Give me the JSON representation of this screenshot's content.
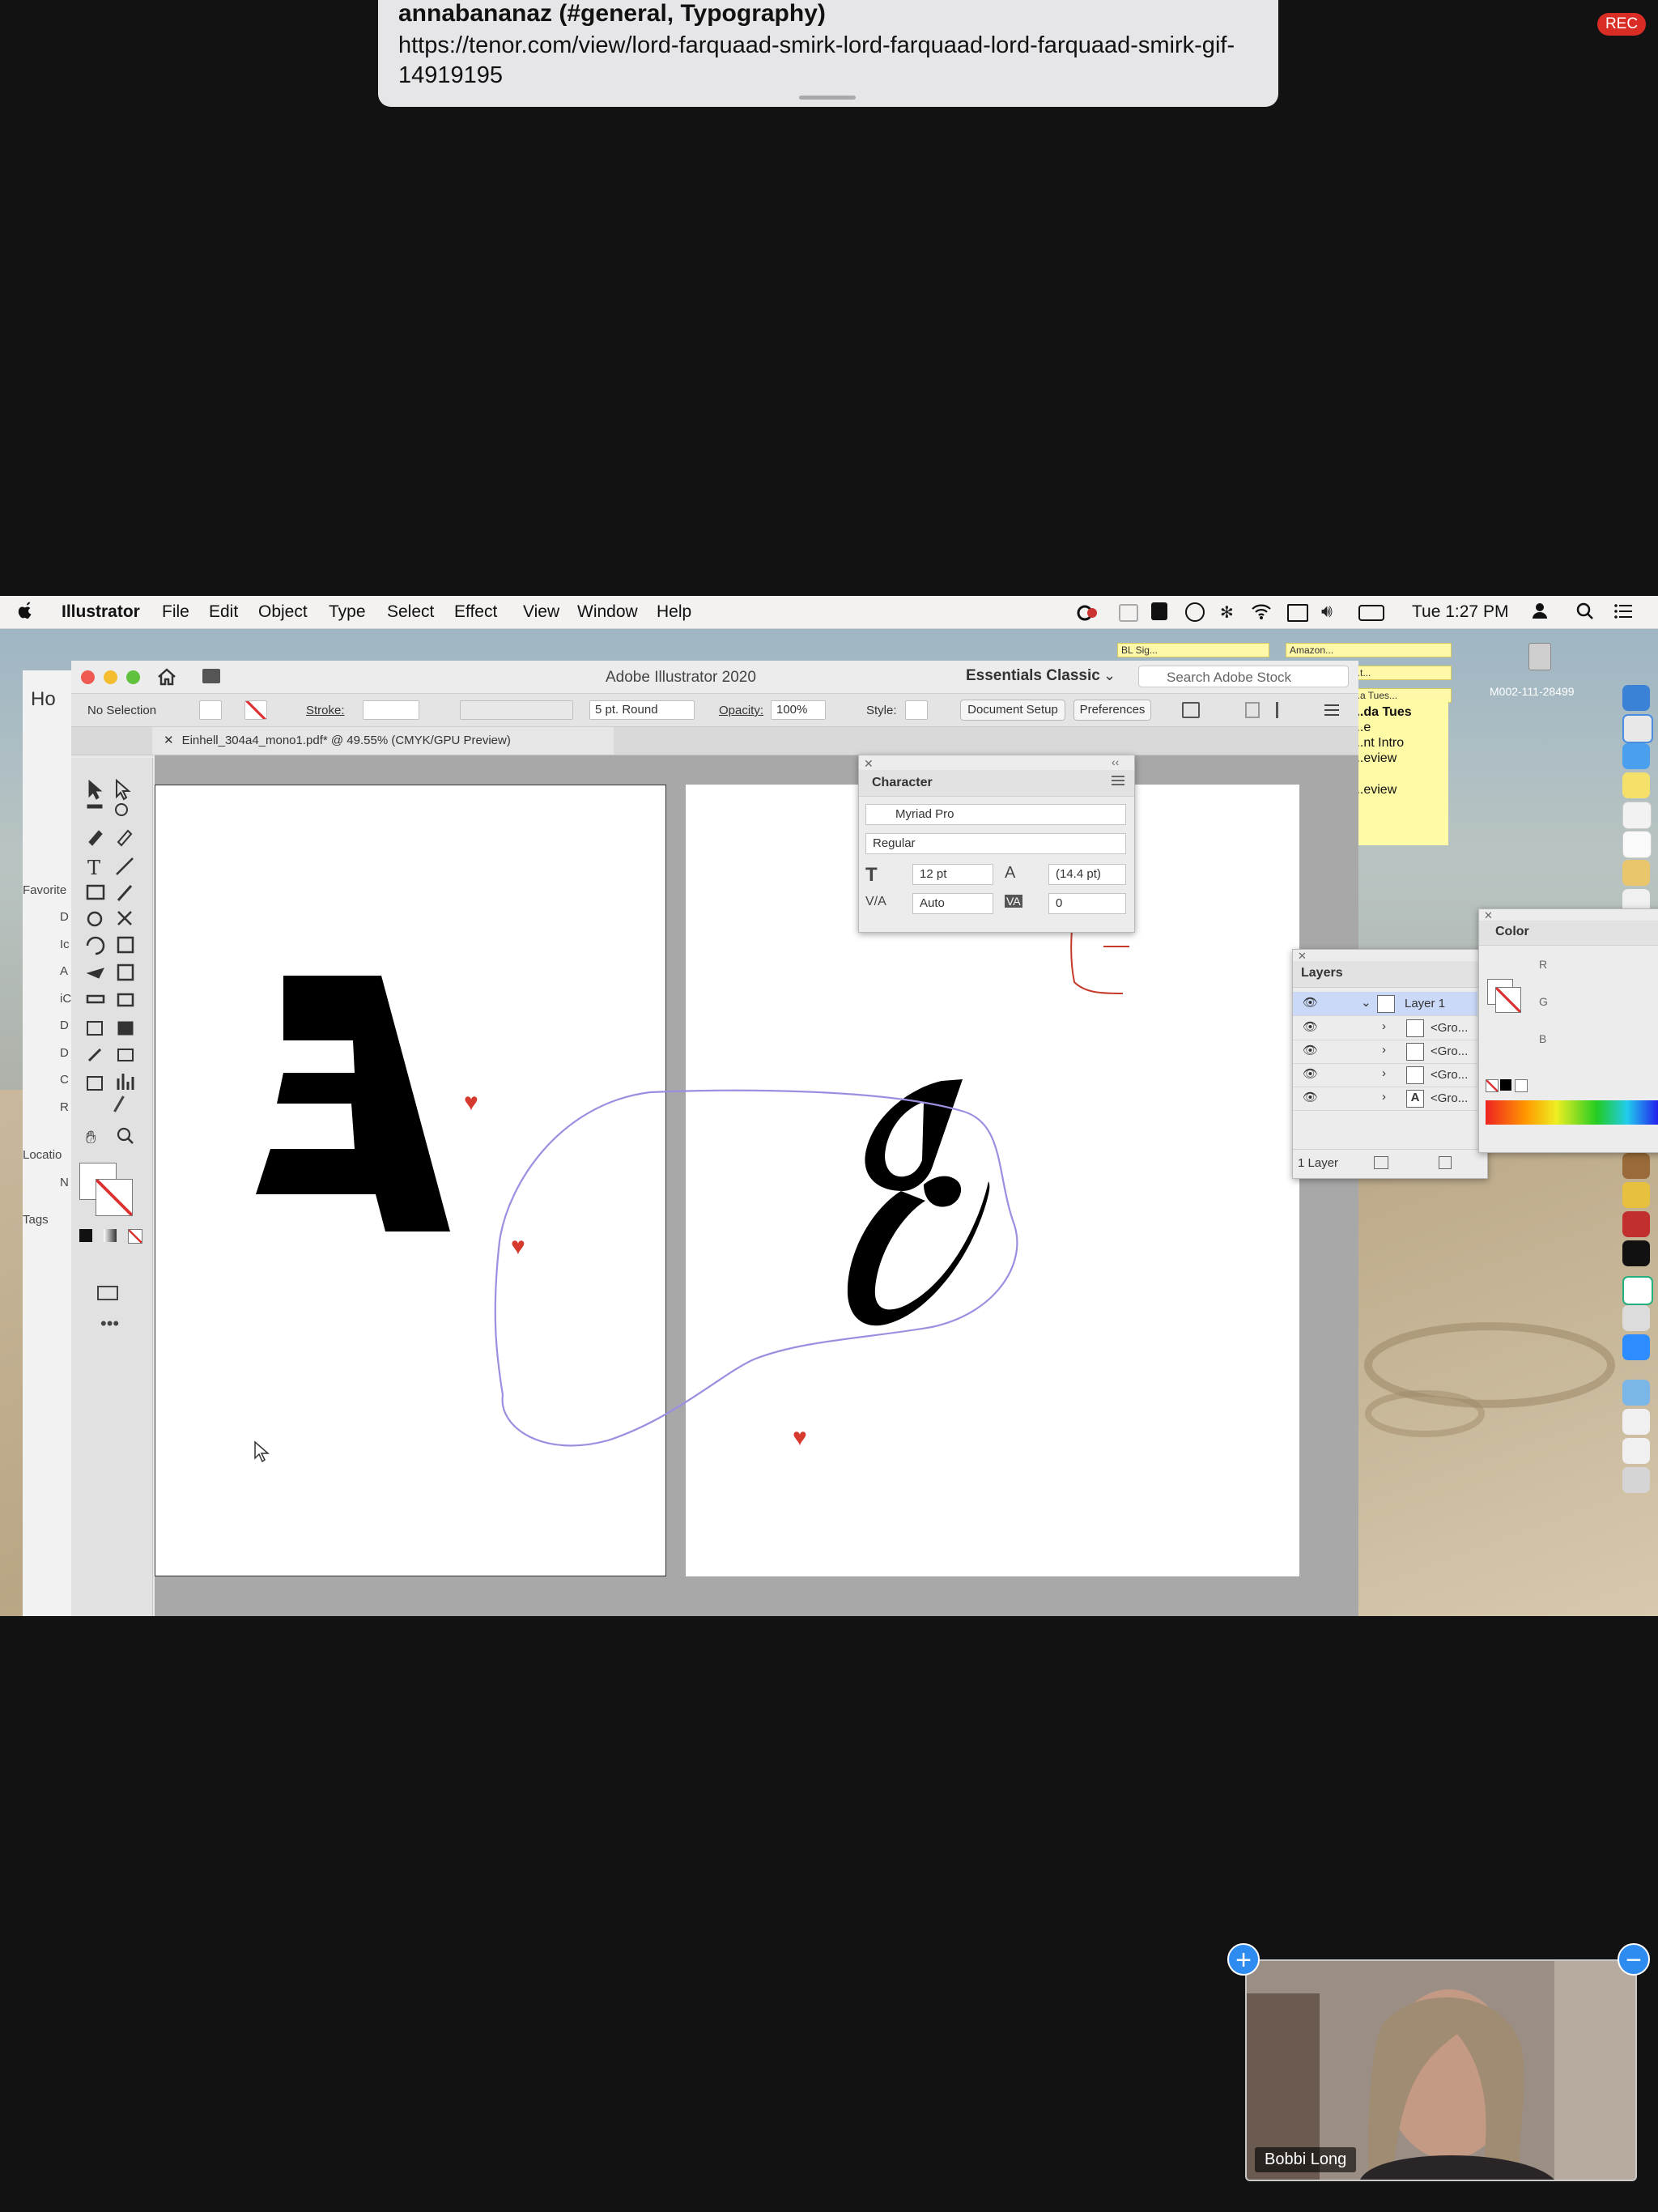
{
  "notification": {
    "sender": "annabananaz (#general, Typography)",
    "message": "https://tenor.com/view/lord-farquaad-smirk-lord-farquaad-lord-farquaad-smirk-gif-14919195"
  },
  "rec_badge": "REC",
  "menubar": {
    "app": "Illustrator",
    "items": [
      "File",
      "Edit",
      "Object",
      "Type",
      "Select",
      "Effect",
      "View",
      "Window",
      "Help"
    ],
    "clock": "Tue 1:27 PM"
  },
  "desktop": {
    "notes": [
      "BL Sig...",
      "Amazon...",
      "...t...",
      "...a Tues..."
    ],
    "sticky_lines": [
      "...da Tues",
      "...e",
      "...nt Intro",
      "...eview",
      "...eview"
    ],
    "disk_label": "M002-111-28499"
  },
  "finder": {
    "home_label": "Ho",
    "section_favorites": "Favorite",
    "items": [
      "D",
      "Ic",
      "A",
      "iC",
      "D",
      "D",
      "C",
      "R"
    ],
    "section_locations": "Locatio",
    "loc_item": "N",
    "section_tags": "Tags"
  },
  "illustrator": {
    "window_title": "Adobe Illustrator 2020",
    "workspace": "Essentials Classic",
    "search_placeholder": "Search Adobe Stock",
    "control": {
      "selection": "No Selection",
      "stroke_label": "Stroke:",
      "brush": "5 pt. Round",
      "opacity_label": "Opacity:",
      "opacity": "100%",
      "style_label": "Style:",
      "document_setup": "Document Setup",
      "preferences": "Preferences"
    },
    "tab_title": "Einhell_304a4_mono1.pdf* @ 49.55% (CMYK/GPU Preview)"
  },
  "character_panel": {
    "title": "Character",
    "font_family": "Myriad Pro",
    "font_style": "Regular",
    "font_size": "12 pt",
    "leading": "(14.4 pt)",
    "kerning": "Auto",
    "tracking": "0"
  },
  "layers_panel": {
    "title": "Layers",
    "layer_name": "Layer 1",
    "sublayers": [
      "<Gro...",
      "<Gro...",
      "<Gro...",
      "<Gro..."
    ],
    "footer": "1 Layer"
  },
  "color_panel": {
    "title": "Color",
    "channels": [
      "R",
      "G",
      "B"
    ]
  },
  "video": {
    "participant": "Bobbi Long",
    "add_icon": "+",
    "remove_icon": "−"
  },
  "colors": {
    "background": "#121213",
    "rec_red": "#d92c24",
    "annotation_purple": "#9a8fe0",
    "annotation_red": "#c53a2b",
    "heart_red": "#d6392e",
    "zoom_blue": "#2e8cf0"
  }
}
